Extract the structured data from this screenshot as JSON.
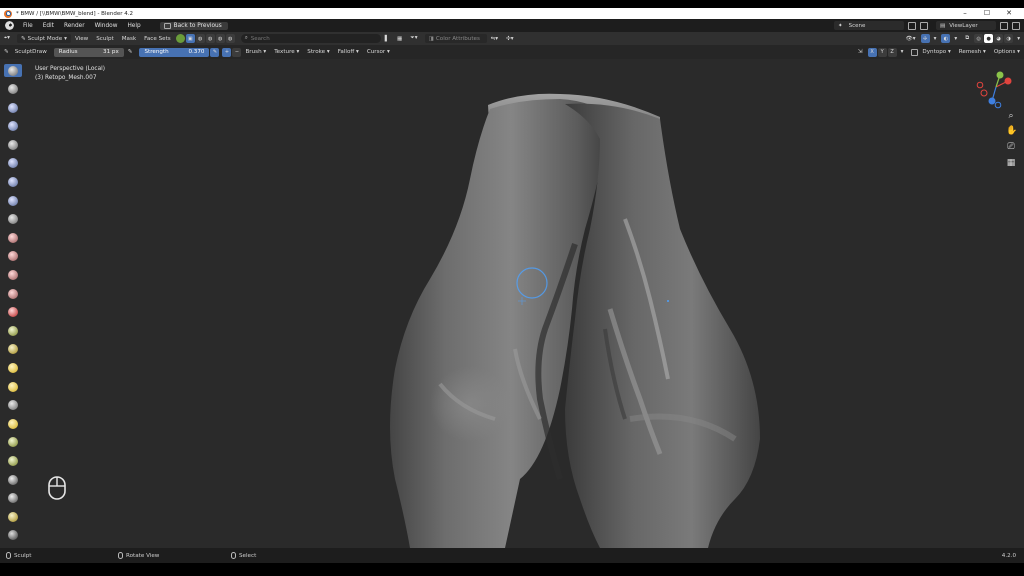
{
  "window": {
    "title": "* BMW / [\\\\BMW\\BMW_blend] - Blender 4.2",
    "controls": [
      "–",
      "☐",
      "✕"
    ]
  },
  "menubar": {
    "items": [
      "File",
      "Edit",
      "Render",
      "Window",
      "Help"
    ],
    "back_button": "Back to Previous",
    "scene_label": "Scene",
    "view_layer_label": "ViewLayer"
  },
  "header": {
    "mode": "Sculpt Mode",
    "menus": [
      "View",
      "Sculpt",
      "Mask",
      "Face Sets"
    ],
    "search_placeholder": "Search",
    "color_attr": "Color Attributes"
  },
  "tool_settings": {
    "brush_name": "SculptDraw",
    "radius_label": "Radius",
    "radius_value": "31 px",
    "strength_label": "Strength",
    "strength_value": "0.370",
    "dropdowns": [
      "Brush",
      "Texture",
      "Stroke",
      "Falloff",
      "Cursor"
    ],
    "axes": [
      "X",
      "Y",
      "Z"
    ],
    "right_dropdowns": [
      "Dyntopo",
      "Remesh",
      "Options"
    ]
  },
  "viewport": {
    "perspective": "User Perspective (Local)",
    "object": "(3) Retopo_Mesh.007",
    "gizmo_axes": {
      "x": "X",
      "y": "Y",
      "z": "Z"
    },
    "colors": {
      "background": "#2a2a2a",
      "mesh": "#6e6e6e",
      "x_axis": "#e0443e",
      "y_axis": "#8bc34a",
      "z_axis": "#3f7fe0",
      "brush_cursor": "#4ea2ff"
    }
  },
  "left_toolbar": {
    "tool_icons": [
      "draw-brush-icon",
      "draw-sharp-icon",
      "clay-icon",
      "clay-strips-icon",
      "clay-thumb-icon",
      "layer-icon",
      "inflate-icon",
      "blob-icon",
      "crease-icon",
      "smooth-icon",
      "flatten-icon",
      "fill-icon",
      "scrape-icon",
      "multiplane-scrape-icon",
      "pinch-icon",
      "grab-icon",
      "elastic-deform-icon",
      "snake-hook-icon",
      "thumb-icon",
      "pose-icon",
      "nudge-icon",
      "rotate-icon",
      "slide-relax-icon",
      "boundary-icon",
      "cloth-icon",
      "simplify-icon",
      "mask-icon",
      "draw-face-sets-icon",
      "annotate-icon"
    ]
  },
  "statusbar": {
    "left": "Sculpt",
    "middle": "Rotate View",
    "right": "Select",
    "version": "4.2.0"
  }
}
